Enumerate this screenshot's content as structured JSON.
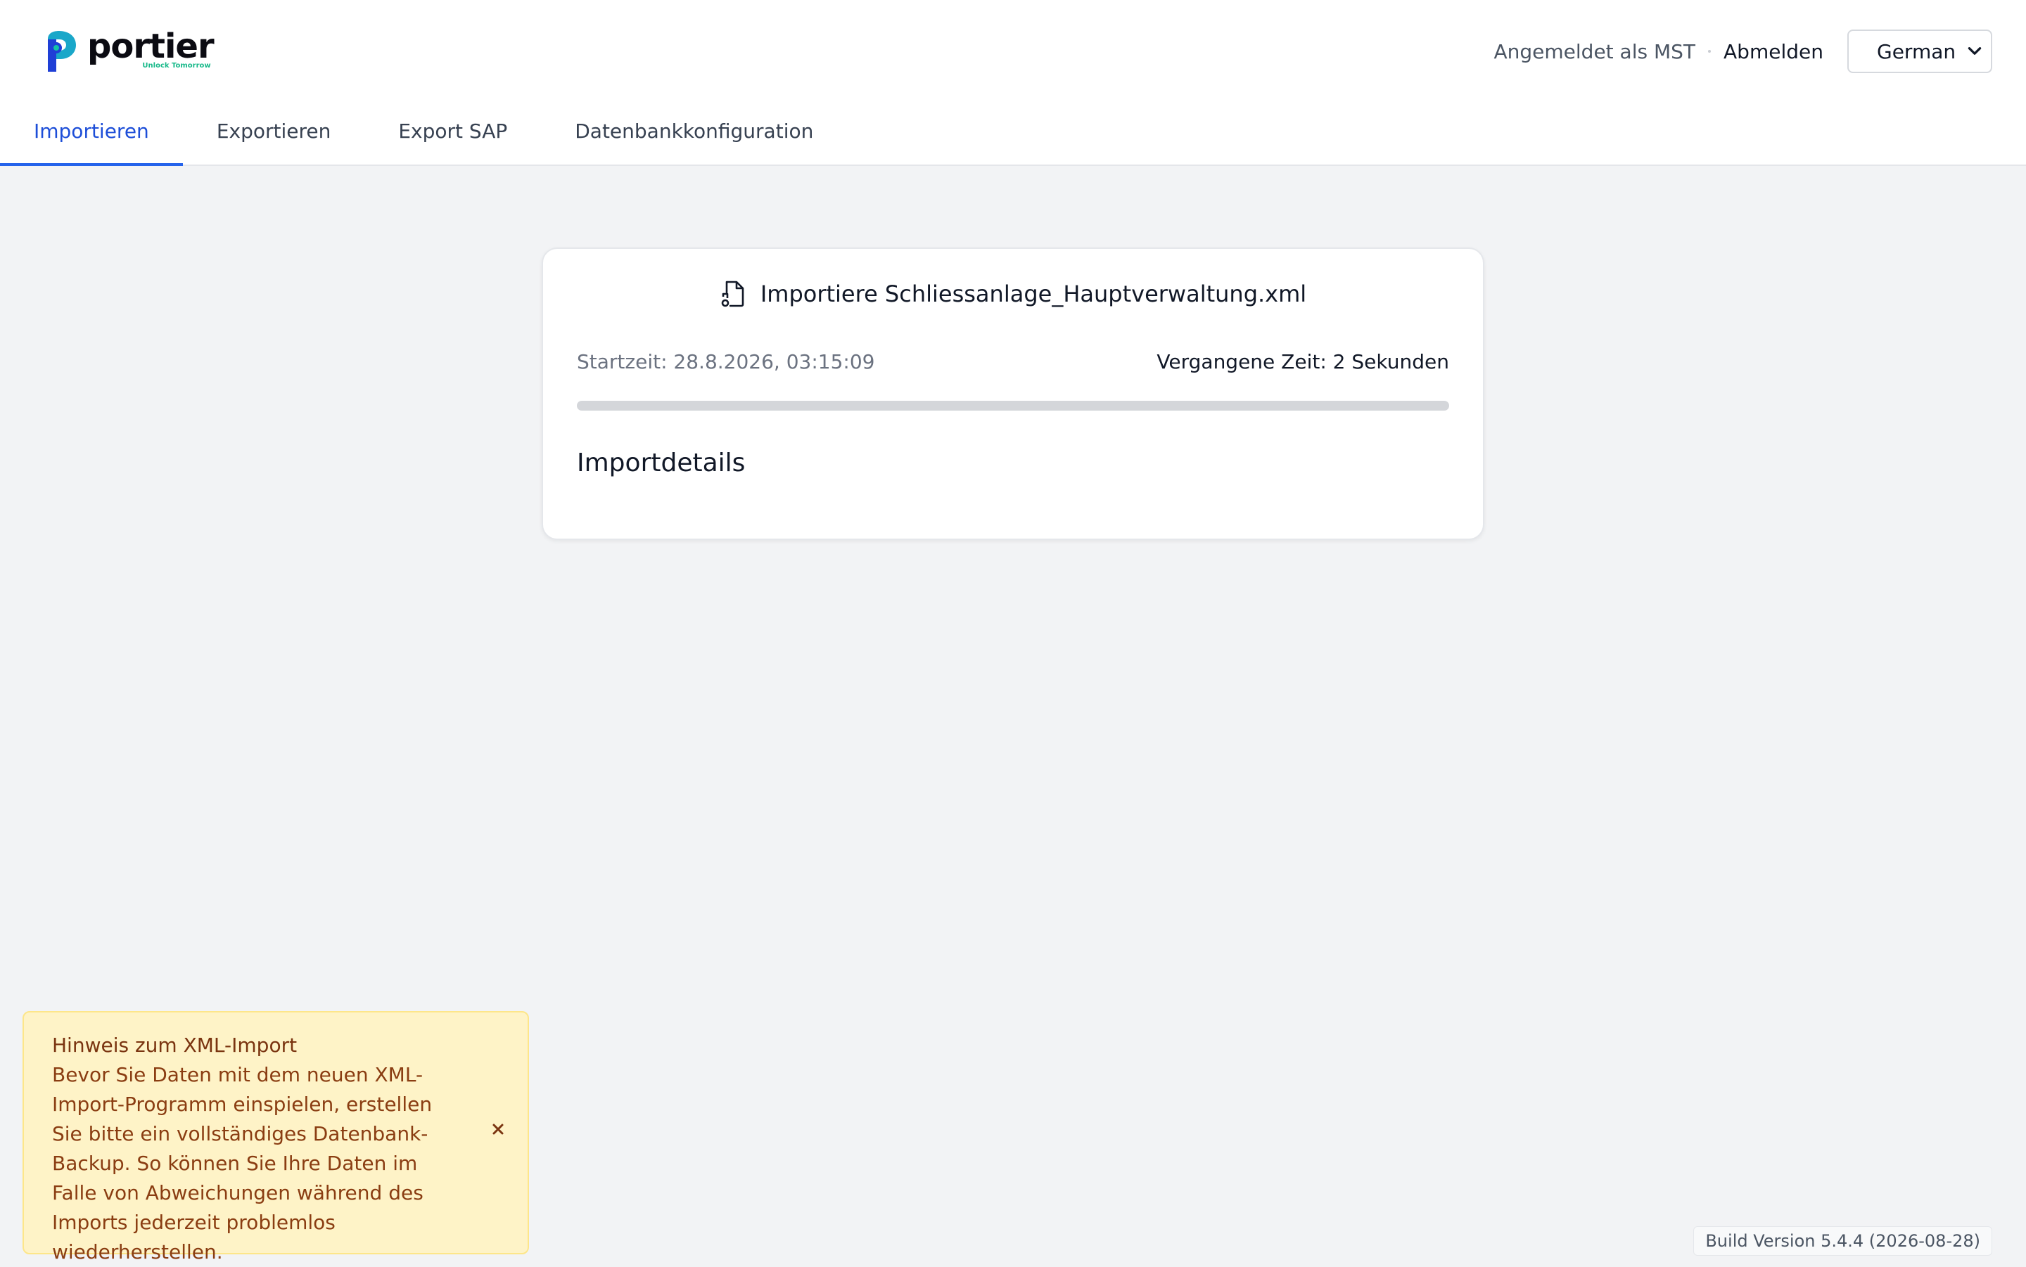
{
  "header": {
    "brand_name": "portier",
    "brand_tagline": "Unlock Tomorrow",
    "logged_in_text": "Angemeldet als MST",
    "logout_label": "Abmelden",
    "language": {
      "selected": "German"
    }
  },
  "tabs": [
    {
      "label": "Importieren",
      "active": true
    },
    {
      "label": "Exportieren",
      "active": false
    },
    {
      "label": "Export SAP",
      "active": false
    },
    {
      "label": "Datenbankkonfiguration",
      "active": false
    }
  ],
  "import_card": {
    "title": "Importiere Schliessanlage_Hauptverwaltung.xml",
    "start_time": "Startzeit: 28.8.2026, 03:15:09",
    "elapsed_time": "Vergangene Zeit: 2 Sekunden",
    "progress_fraction": 0,
    "details_heading": "Importdetails"
  },
  "notice": {
    "title": "Hinweis zum XML-Import",
    "body": "Bevor Sie Daten mit dem neuen XML-Import-Programm einspielen, erstellen Sie bitte ein vollständiges Datenbank-Backup. So können Sie Ihre Daten im Falle von Abweichungen während des Imports jederzeit problemlos wiederherstellen."
  },
  "footer": {
    "build_version": "Build Version 5.4.4 (2026-08-28)"
  },
  "colors": {
    "accent": "#2563eb",
    "brand_green": "#18b98a",
    "notice_bg": "#fef3c7",
    "notice_text": "#7a3410"
  },
  "icons": {
    "file_icon": "file-import-icon",
    "close_icon": "close-icon",
    "select_chevron": "chevron-down-icon"
  }
}
